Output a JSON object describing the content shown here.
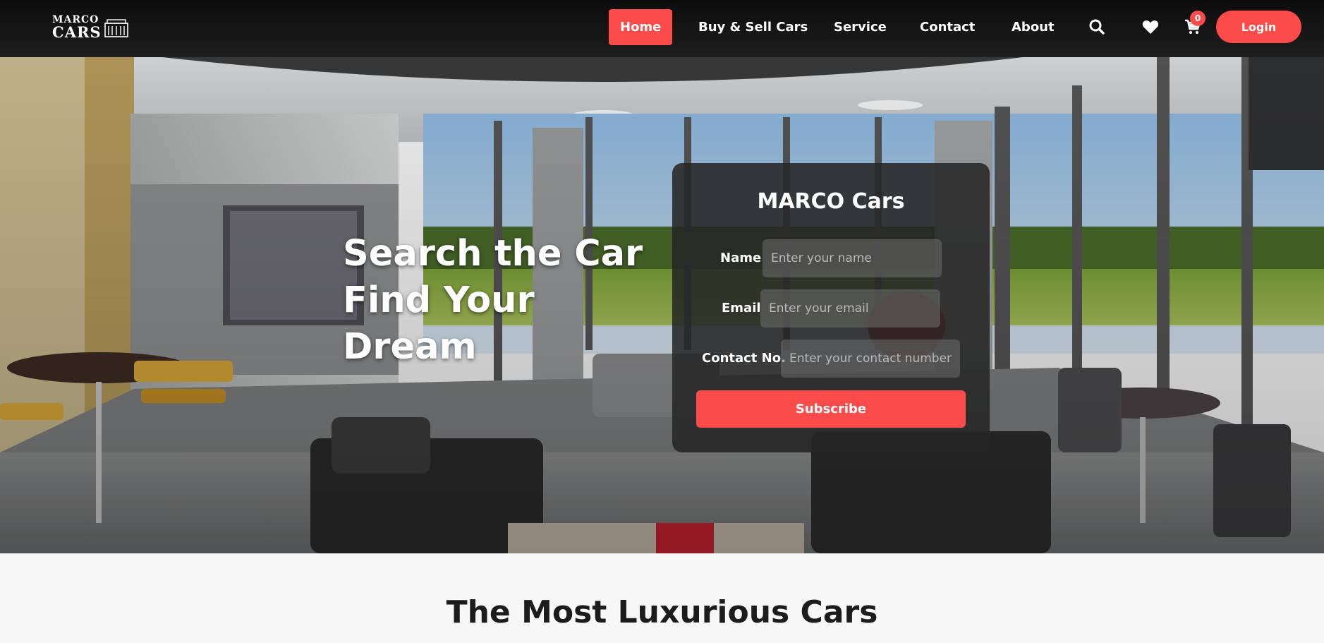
{
  "brand": {
    "logo_line1": "MARCO",
    "logo_line2": "CARS"
  },
  "nav": {
    "items": [
      {
        "label": "Home",
        "active": true
      },
      {
        "label": "Buy & Sell Cars",
        "active": false
      },
      {
        "label": "Service",
        "active": false
      },
      {
        "label": "Contact",
        "active": false
      },
      {
        "label": "About",
        "active": false
      }
    ],
    "cart_count": "0",
    "login_label": "Login",
    "icons": [
      "search-icon",
      "heart-icon",
      "cart-icon"
    ]
  },
  "hero": {
    "headline_lines": [
      "Search the Car",
      "Find Your",
      "Dream"
    ]
  },
  "form": {
    "title": "MARCO Cars",
    "name_label": "Name",
    "name_placeholder": "Enter your name",
    "email_label": "Email",
    "email_placeholder": "Enter your email",
    "contact_label": "Contact No.",
    "contact_placeholder": "Enter your contact number",
    "submit_label": "Subscribe"
  },
  "section": {
    "title": "The Most Luxurious Cars"
  },
  "colors": {
    "accent": "#fc4b4b",
    "nav_bg": "#141414",
    "page_bg": "#f7f7f7"
  }
}
